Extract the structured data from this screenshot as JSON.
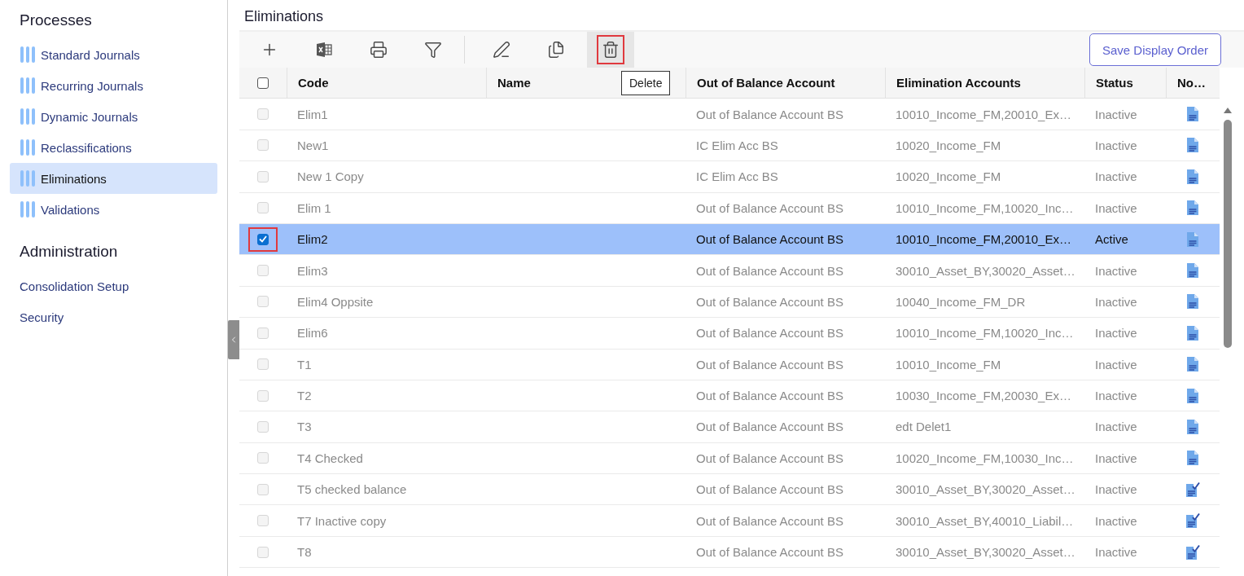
{
  "sidebar": {
    "sections": [
      {
        "title": "Processes",
        "items": [
          {
            "label": "Standard Journals",
            "kind": "journal",
            "selected": false
          },
          {
            "label": "Recurring Journals",
            "kind": "journal",
            "selected": false
          },
          {
            "label": "Dynamic Journals",
            "kind": "journal",
            "selected": false
          },
          {
            "label": "Reclassifications",
            "kind": "journal",
            "selected": false
          },
          {
            "label": "Eliminations",
            "kind": "journal",
            "selected": true
          },
          {
            "label": "Validations",
            "kind": "journal",
            "selected": false
          }
        ]
      },
      {
        "title": "Administration",
        "items": [
          {
            "label": "Consolidation Setup",
            "kind": "link",
            "selected": false
          },
          {
            "label": "Security",
            "kind": "link",
            "selected": false
          }
        ]
      }
    ]
  },
  "page": {
    "title": "Eliminations"
  },
  "toolbar": {
    "groups": [
      [
        {
          "kind": "add",
          "highlighted": false
        },
        {
          "kind": "excel",
          "highlighted": false
        },
        {
          "kind": "print",
          "highlighted": false
        },
        {
          "kind": "filter",
          "highlighted": false
        }
      ],
      [
        {
          "kind": "edit",
          "highlighted": false
        },
        {
          "kind": "copy",
          "highlighted": false
        },
        {
          "kind": "delete",
          "highlighted": true
        }
      ]
    ],
    "tooltip": "Delete",
    "save_button": "Save Display Order"
  },
  "table": {
    "select_all_checked": false,
    "columns": [
      "Code",
      "Name",
      "Out of Balance Account",
      "Elimination Accounts",
      "Status",
      "No…"
    ],
    "rows": [
      {
        "code": "Elim1",
        "oob": "Out of Balance Account BS",
        "accounts": "10010_Income_FM,20010_Ex…",
        "status": "Inactive",
        "kind": "plain",
        "selected": false,
        "marked": false
      },
      {
        "code": "New1",
        "oob": "IC Elim Acc BS",
        "accounts": "10020_Income_FM",
        "status": "Inactive",
        "kind": "plain",
        "selected": false,
        "marked": false
      },
      {
        "code": "New 1 Copy",
        "oob": "IC Elim Acc BS",
        "accounts": "10020_Income_FM",
        "status": "Inactive",
        "kind": "plain",
        "selected": false,
        "marked": false
      },
      {
        "code": "Elim 1",
        "oob": "Out of Balance Account BS",
        "accounts": "10010_Income_FM,10020_Inc…",
        "status": "Inactive",
        "kind": "plain",
        "selected": false,
        "marked": false
      },
      {
        "code": "Elim2",
        "oob": "Out of Balance Account BS",
        "accounts": "10010_Income_FM,20010_Ex…",
        "status": "Active",
        "kind": "plain",
        "selected": true,
        "marked": true
      },
      {
        "code": "Elim3",
        "oob": "Out of Balance Account BS",
        "accounts": "30010_Asset_BY,30020_Asset…",
        "status": "Inactive",
        "kind": "plain",
        "selected": false,
        "marked": false
      },
      {
        "code": "Elim4 Oppsite",
        "oob": "Out of Balance Account BS",
        "accounts": "10040_Income_FM_DR",
        "status": "Inactive",
        "kind": "plain",
        "selected": false,
        "marked": false
      },
      {
        "code": "Elim6",
        "oob": "Out of Balance Account BS",
        "accounts": "10010_Income_FM,10020_Inc…",
        "status": "Inactive",
        "kind": "plain",
        "selected": false,
        "marked": false
      },
      {
        "code": "T1",
        "oob": "Out of Balance Account BS",
        "accounts": "10010_Income_FM",
        "status": "Inactive",
        "kind": "plain",
        "selected": false,
        "marked": false
      },
      {
        "code": "T2",
        "oob": "Out of Balance Account BS",
        "accounts": "10030_Income_FM,20030_Ex…",
        "status": "Inactive",
        "kind": "plain",
        "selected": false,
        "marked": false
      },
      {
        "code": "T3",
        "oob": "Out of Balance Account BS",
        "accounts": "edt Delet1",
        "status": "Inactive",
        "kind": "plain",
        "selected": false,
        "marked": false
      },
      {
        "code": "T4 Checked",
        "oob": "Out of Balance Account BS",
        "accounts": "10020_Income_FM,10030_Inc…",
        "status": "Inactive",
        "kind": "plain",
        "selected": false,
        "marked": false
      },
      {
        "code": "T5 checked balance",
        "oob": "Out of Balance Account BS",
        "accounts": "30010_Asset_BY,30020_Asset…",
        "status": "Inactive",
        "kind": "checked",
        "selected": false,
        "marked": false
      },
      {
        "code": "T7 Inactive copy",
        "oob": "Out of Balance Account BS",
        "accounts": "30010_Asset_BY,40010_Liabil…",
        "status": "Inactive",
        "kind": "checked",
        "selected": false,
        "marked": false
      },
      {
        "code": "T8",
        "oob": "Out of Balance Account BS",
        "accounts": "30010_Asset_BY,30020_Asset…",
        "status": "Inactive",
        "kind": "checked",
        "selected": false,
        "marked": false
      }
    ]
  }
}
